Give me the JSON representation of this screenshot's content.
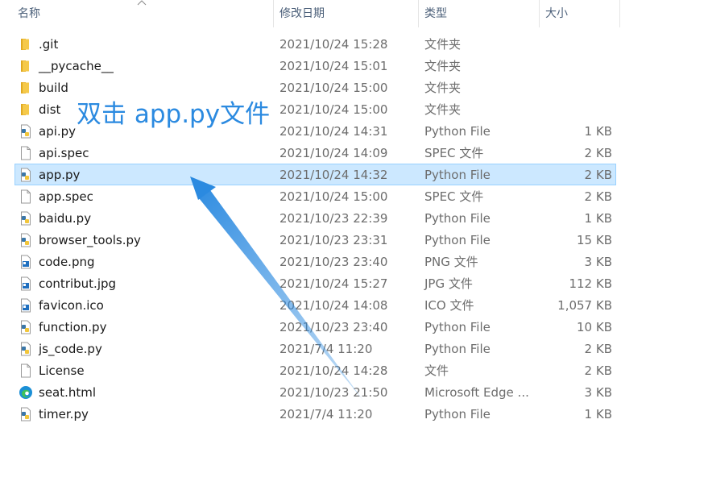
{
  "header": {
    "name_label": "名称",
    "date_label": "修改日期",
    "type_label": "类型",
    "size_label": "大小"
  },
  "files": [
    {
      "name": ".git",
      "date": "2021/10/24 15:28",
      "type": "文件夹",
      "size": "",
      "icon": "folder-icon"
    },
    {
      "name": "__pycache__",
      "date": "2021/10/24 15:01",
      "type": "文件夹",
      "size": "",
      "icon": "folder-icon"
    },
    {
      "name": "build",
      "date": "2021/10/24 15:00",
      "type": "文件夹",
      "size": "",
      "icon": "folder-icon"
    },
    {
      "name": "dist",
      "date": "2021/10/24 15:00",
      "type": "文件夹",
      "size": "",
      "icon": "folder-icon"
    },
    {
      "name": "api.py",
      "date": "2021/10/24 14:31",
      "type": "Python File",
      "size": "1 KB",
      "icon": "python-file-icon"
    },
    {
      "name": "api.spec",
      "date": "2021/10/24 14:09",
      "type": "SPEC 文件",
      "size": "2 KB",
      "icon": "blank-file-icon"
    },
    {
      "name": "app.py",
      "date": "2021/10/24 14:32",
      "type": "Python File",
      "size": "2 KB",
      "icon": "python-file-icon",
      "selected": true
    },
    {
      "name": "app.spec",
      "date": "2021/10/24 15:00",
      "type": "SPEC 文件",
      "size": "2 KB",
      "icon": "blank-file-icon"
    },
    {
      "name": "baidu.py",
      "date": "2021/10/23 22:39",
      "type": "Python File",
      "size": "1 KB",
      "icon": "python-file-icon"
    },
    {
      "name": "browser_tools.py",
      "date": "2021/10/23 23:31",
      "type": "Python File",
      "size": "15 KB",
      "icon": "python-file-icon"
    },
    {
      "name": "code.png",
      "date": "2021/10/23 23:40",
      "type": "PNG 文件",
      "size": "3 KB",
      "icon": "image-file-icon"
    },
    {
      "name": "contribut.jpg",
      "date": "2021/10/24 15:27",
      "type": "JPG 文件",
      "size": "112 KB",
      "icon": "image-file-icon"
    },
    {
      "name": "favicon.ico",
      "date": "2021/10/24 14:08",
      "type": "ICO 文件",
      "size": "1,057 KB",
      "icon": "image-file-icon"
    },
    {
      "name": "function.py",
      "date": "2021/10/23 23:40",
      "type": "Python File",
      "size": "10 KB",
      "icon": "python-file-icon"
    },
    {
      "name": "js_code.py",
      "date": "2021/7/4 11:20",
      "type": "Python File",
      "size": "2 KB",
      "icon": "python-file-icon"
    },
    {
      "name": "License",
      "date": "2021/10/24 14:28",
      "type": "文件",
      "size": "2 KB",
      "icon": "blank-file-icon"
    },
    {
      "name": "seat.html",
      "date": "2021/10/23 21:50",
      "type": "Microsoft Edge ...",
      "size": "3 KB",
      "icon": "edge-icon"
    },
    {
      "name": "timer.py",
      "date": "2021/7/4 11:20",
      "type": "Python File",
      "size": "1 KB",
      "icon": "python-file-icon"
    }
  ],
  "annotation": {
    "text": "双击 app.py文件"
  },
  "colors": {
    "selection_bg": "#cce8ff",
    "selection_border": "#99d1ff",
    "annotation": "#2b8ae0",
    "folder": "#f5c94a"
  }
}
